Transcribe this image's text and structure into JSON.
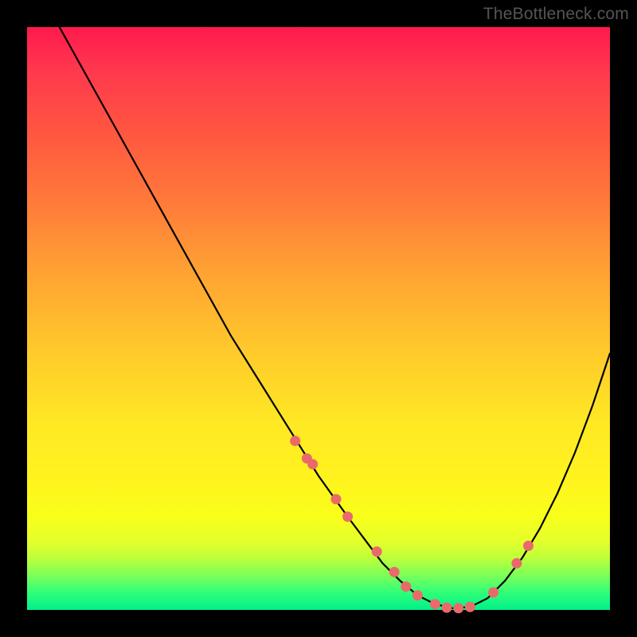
{
  "watermark": "TheBottleneck.com",
  "colors": {
    "background": "#000000",
    "curve_stroke": "#000000",
    "marker_fill": "#ea6a6a",
    "marker_stroke": "#d85656"
  },
  "chart_data": {
    "type": "line",
    "title": "",
    "xlabel": "",
    "ylabel": "",
    "xlim": [
      0,
      100
    ],
    "ylim": [
      0,
      100
    ],
    "x": [
      0,
      5,
      10,
      15,
      20,
      25,
      30,
      35,
      40,
      45,
      50,
      55,
      58,
      61,
      64,
      67,
      70,
      73,
      76,
      79,
      82,
      85,
      88,
      91,
      94,
      97,
      100
    ],
    "values": [
      110,
      101,
      92,
      83,
      74,
      65,
      56,
      47,
      39,
      31,
      23,
      16,
      12,
      8,
      5,
      2.5,
      1,
      0.3,
      0.5,
      2,
      5,
      9,
      14,
      20,
      27,
      35,
      44
    ],
    "markers": {
      "x": [
        46,
        48,
        49,
        53,
        55,
        60,
        63,
        65,
        67,
        70,
        72,
        74,
        76,
        80,
        84,
        86
      ],
      "values": [
        29,
        26,
        25,
        19,
        16,
        10,
        6.5,
        4,
        2.5,
        1,
        0.4,
        0.3,
        0.5,
        3,
        8,
        11
      ]
    }
  }
}
